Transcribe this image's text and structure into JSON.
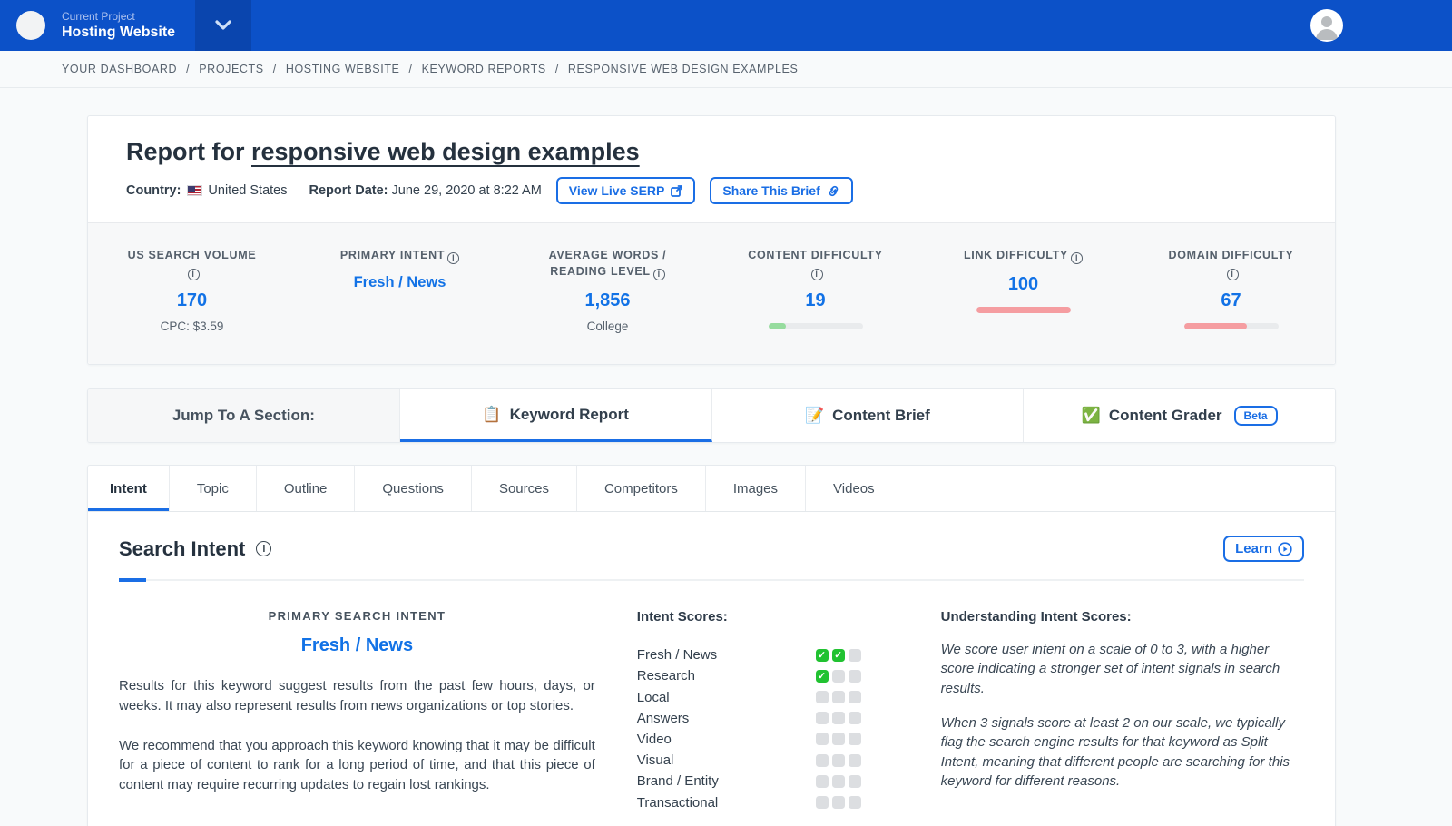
{
  "topbar": {
    "project_label": "Current Project",
    "project_name": "Hosting Website"
  },
  "breadcrumb": {
    "separator": "/",
    "items": [
      "YOUR DASHBOARD",
      "PROJECTS",
      "HOSTING WEBSITE",
      "KEYWORD REPORTS",
      "RESPONSIVE WEB DESIGN EXAMPLES"
    ]
  },
  "report_header": {
    "title_prefix": "Report for ",
    "keyword": "responsive web design examples",
    "country_label": "Country:",
    "country_value": "United States",
    "date_label": "Report Date:",
    "date_value": "June 29, 2020 at 8:22 AM",
    "view_serp_button": "View Live SERP",
    "share_brief_button": "Share This Brief"
  },
  "stats": [
    {
      "label": "US Search Volume",
      "value": "170",
      "sub": "CPC: $3.59"
    },
    {
      "label": "Primary Intent",
      "value": "Fresh / News"
    },
    {
      "label": "Average Words / Reading Level",
      "value": "1,856",
      "sub": "College"
    },
    {
      "label": "Content Difficulty",
      "value": "19",
      "bar_width": "19%"
    },
    {
      "label": "Link Difficulty",
      "value": "100",
      "bar_width": "100%"
    },
    {
      "label": "Domain Difficulty",
      "value": "67",
      "bar_width": "67%"
    }
  ],
  "jump": {
    "label": "Jump To A Section:",
    "sections": [
      {
        "icon": "📋",
        "label": "Keyword Report"
      },
      {
        "icon": "📝",
        "label": "Content Brief"
      },
      {
        "icon": "✅",
        "label": "Content Grader",
        "badge": "Beta"
      }
    ]
  },
  "tabs": [
    "Intent",
    "Topic",
    "Outline",
    "Questions",
    "Sources",
    "Competitors",
    "Images",
    "Videos"
  ],
  "intent_section": {
    "title": "Search Intent",
    "learn_button": "Learn",
    "primary_label": "Primary Search Intent",
    "primary_value": "Fresh / News",
    "para1": "Results for this keyword suggest results from the past few hours, days, or weeks. It may also represent results from news organizations or top stories.",
    "para2": "We recommend that you approach this keyword knowing that it may be difficult for a piece of content to rank for a long period of time, and that this piece of content may require recurring updates to regain lost rankings."
  },
  "intent_scores": {
    "heading": "Intent Scores:",
    "max_score": 3,
    "rows": [
      {
        "label": "Fresh / News",
        "score": 2
      },
      {
        "label": "Research",
        "score": 1
      },
      {
        "label": "Local",
        "score": 0
      },
      {
        "label": "Answers",
        "score": 0
      },
      {
        "label": "Video",
        "score": 0
      },
      {
        "label": "Visual",
        "score": 0
      },
      {
        "label": "Brand / Entity",
        "score": 0
      },
      {
        "label": "Transactional",
        "score": 0
      }
    ]
  },
  "understanding": {
    "heading": "Understanding Intent Scores:",
    "para1": "We score user intent on a scale of 0 to 3, with a higher score indicating a stronger set of intent signals in search results.",
    "para2": "When 3 signals score at least 2 on our scale, we typically flag the search engine results for that keyword as Split Intent, meaning that different people are searching for this keyword for different reasons."
  },
  "colors": {
    "topbar_blue": "#0c51c8",
    "topbar_dark_blue": "#0a45ae",
    "accent_blue": "#1a6ee5",
    "value_blue": "#1272e6",
    "difficulty_green": "#96dc9e",
    "difficulty_red": "#f59da1",
    "check_green": "#21c231",
    "square_gray": "#dcdee1"
  }
}
